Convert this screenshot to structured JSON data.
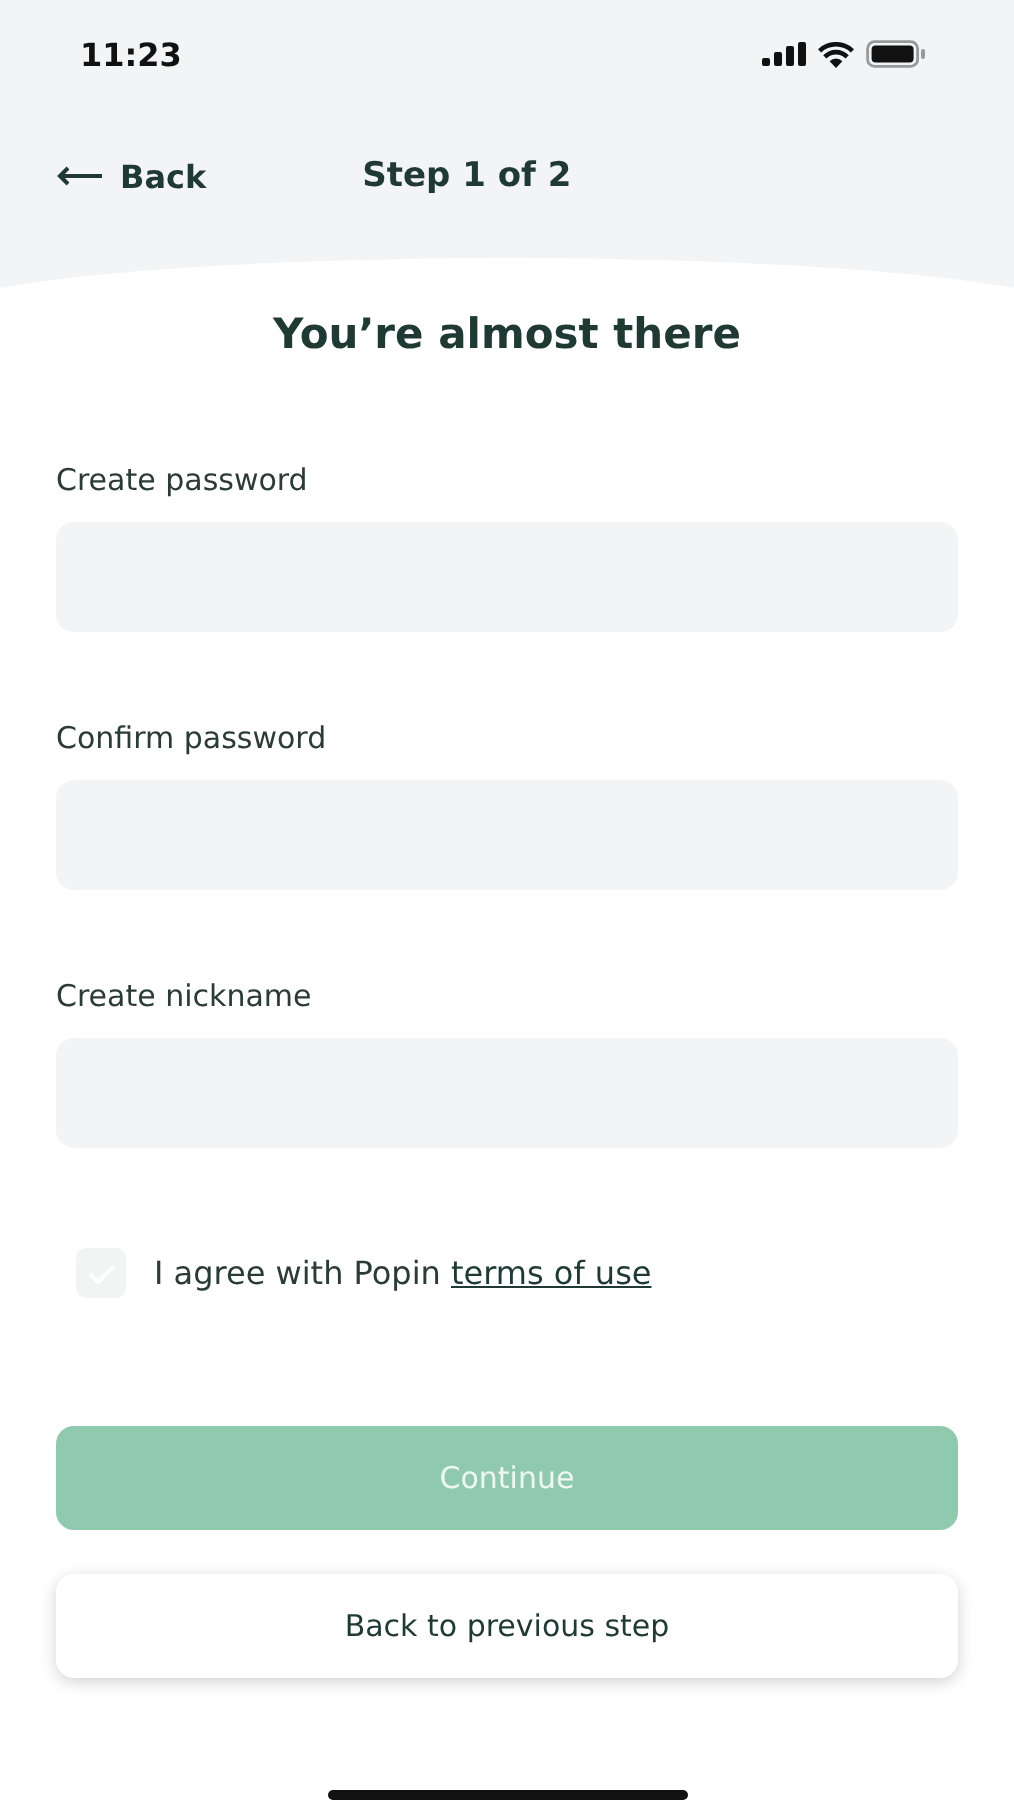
{
  "status_bar": {
    "time": "11:23"
  },
  "header": {
    "back_label": "Back",
    "step": "Step 1 of 2"
  },
  "title": "You’re almost there",
  "fields": [
    {
      "label": "Create password"
    },
    {
      "label": "Confirm password"
    },
    {
      "label": "Create nickname"
    }
  ],
  "agreement": {
    "checked": false,
    "text": "I agree with Popin",
    "link": "terms of use"
  },
  "buttons": [
    {
      "kind": "primary",
      "label": "Continue",
      "disabled": true
    },
    {
      "kind": "secondary",
      "label": "Back to previous step",
      "disabled": false
    }
  ]
}
